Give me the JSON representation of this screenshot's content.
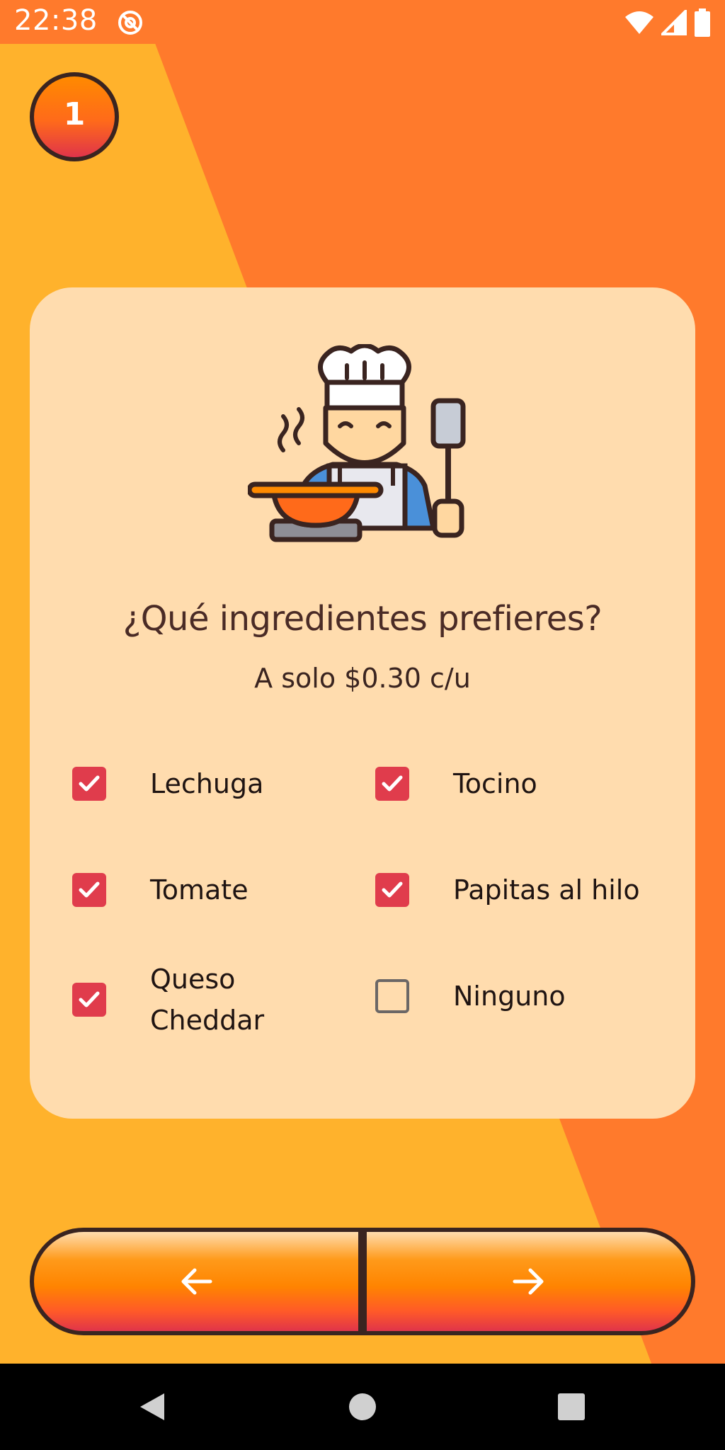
{
  "status_bar": {
    "time": "22:38",
    "left_icon": "sync-at-icon",
    "right_icons": [
      "wifi-icon",
      "signal-icon",
      "battery-icon"
    ]
  },
  "step": {
    "number": "1"
  },
  "card": {
    "illustration": "chef-cooking-illustration",
    "title": "¿Qué ingredientes prefieres?",
    "subtitle": "A solo $0.30 c/u",
    "options": [
      {
        "label": "Lechuga",
        "checked": true
      },
      {
        "label": "Tocino",
        "checked": true
      },
      {
        "label": "Tomate",
        "checked": true
      },
      {
        "label": "Papitas al hilo",
        "checked": true
      },
      {
        "label": "Queso Cheddar",
        "checked": true
      },
      {
        "label": "Ninguno",
        "checked": false
      }
    ]
  },
  "navigation": {
    "back_icon": "arrow-left-icon",
    "next_icon": "arrow-right-icon"
  },
  "system_nav": {
    "buttons": [
      "back-triangle-icon",
      "home-circle-icon",
      "recents-square-icon"
    ]
  },
  "colors": {
    "background_yellow": "#ffb22c",
    "background_orange": "#ff7a2c",
    "card": "#ffdcae",
    "checkbox_checked": "#e03c4c",
    "dark_brown": "#3a2420",
    "title_text": "#4a2b26"
  }
}
